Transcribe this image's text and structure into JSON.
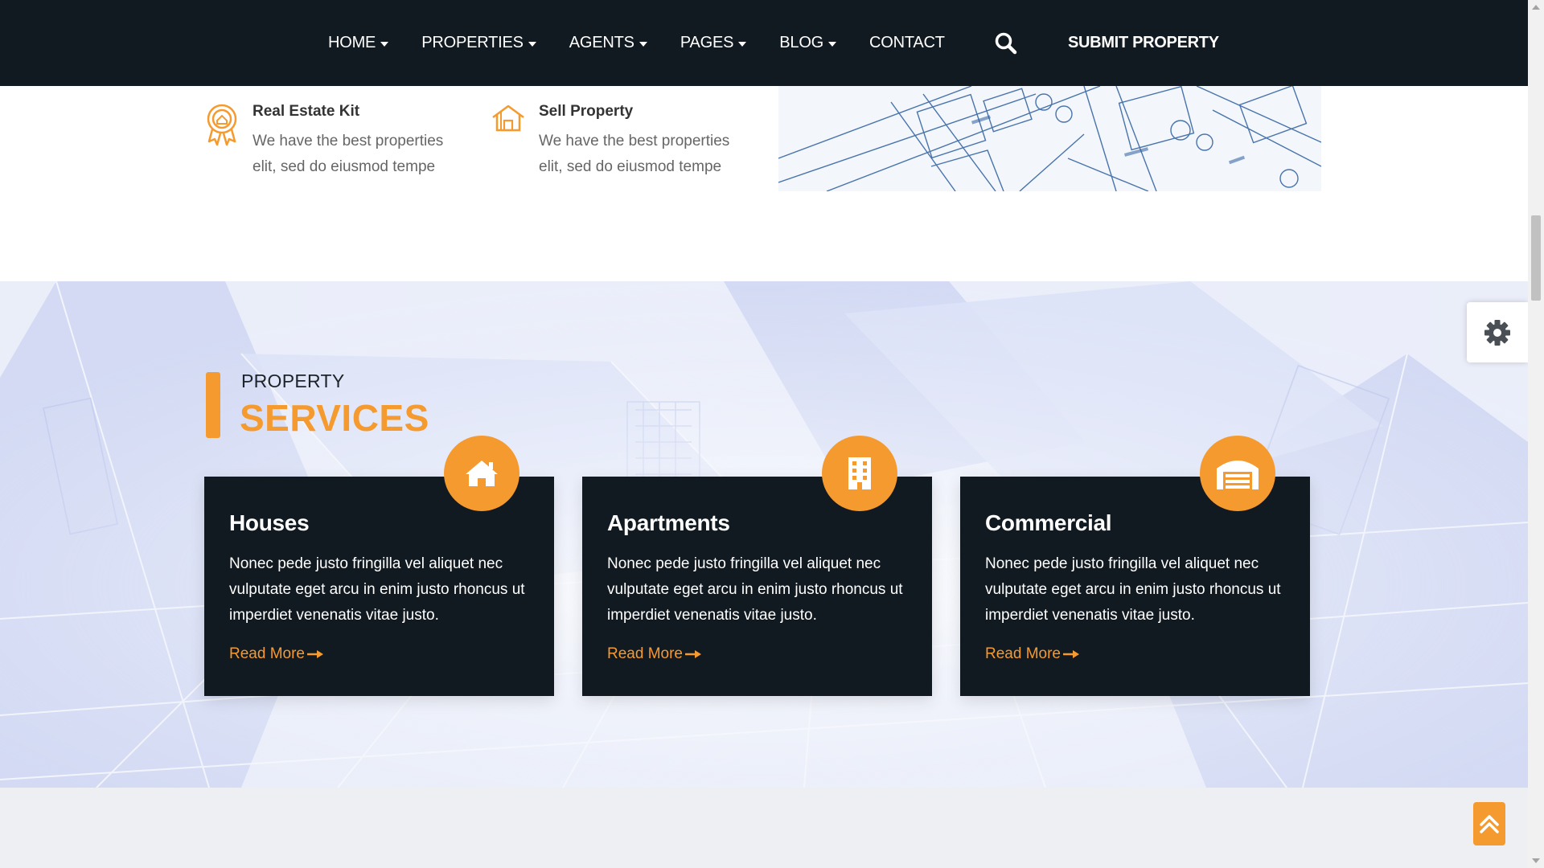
{
  "nav": {
    "items": [
      {
        "label": "HOME",
        "has_dropdown": true
      },
      {
        "label": "PROPERTIES",
        "has_dropdown": true
      },
      {
        "label": "AGENTS",
        "has_dropdown": true
      },
      {
        "label": "PAGES",
        "has_dropdown": true
      },
      {
        "label": "BLOG",
        "has_dropdown": true
      },
      {
        "label": "CONTACT",
        "has_dropdown": false
      }
    ],
    "search_icon": "search-icon",
    "submit_label": "SUBMIT PROPERTY"
  },
  "features": [
    {
      "icon": "award-ribbon-icon",
      "title": "Real Estate Kit",
      "text": "We have the best properties elit, sed do eiusmod tempe"
    },
    {
      "icon": "house-outline-icon",
      "title": "Sell Property",
      "text": "We have the best properties elit, sed do eiusmod tempe"
    }
  ],
  "services": {
    "subtitle": "PROPERTY",
    "title": "SERVICES",
    "cards": [
      {
        "icon": "house-icon",
        "title": "Houses",
        "text": "Nonec pede justo fringilla vel aliquet nec vulputate eget arcu in enim justo rhoncus ut imperdiet venenatis vitae justo.",
        "link": "Read More"
      },
      {
        "icon": "building-icon",
        "title": "Apartments",
        "text": "Nonec pede justo fringilla vel aliquet nec vulputate eget arcu in enim justo rhoncus ut imperdiet venenatis vitae justo.",
        "link": "Read More"
      },
      {
        "icon": "warehouse-icon",
        "title": "Commercial",
        "text": "Nonec pede justo fringilla vel aliquet nec vulputate eget arcu in enim justo rhoncus ut imperdiet venenatis vitae justo.",
        "link": "Read More"
      }
    ]
  },
  "colors": {
    "accent": "#f59a2f",
    "navbar": "#111921",
    "card": "#111921",
    "band": "#eeeff2"
  },
  "widgets": {
    "settings_icon": "gear-icon",
    "back_to_top_icon": "double-chevron-up-icon"
  }
}
